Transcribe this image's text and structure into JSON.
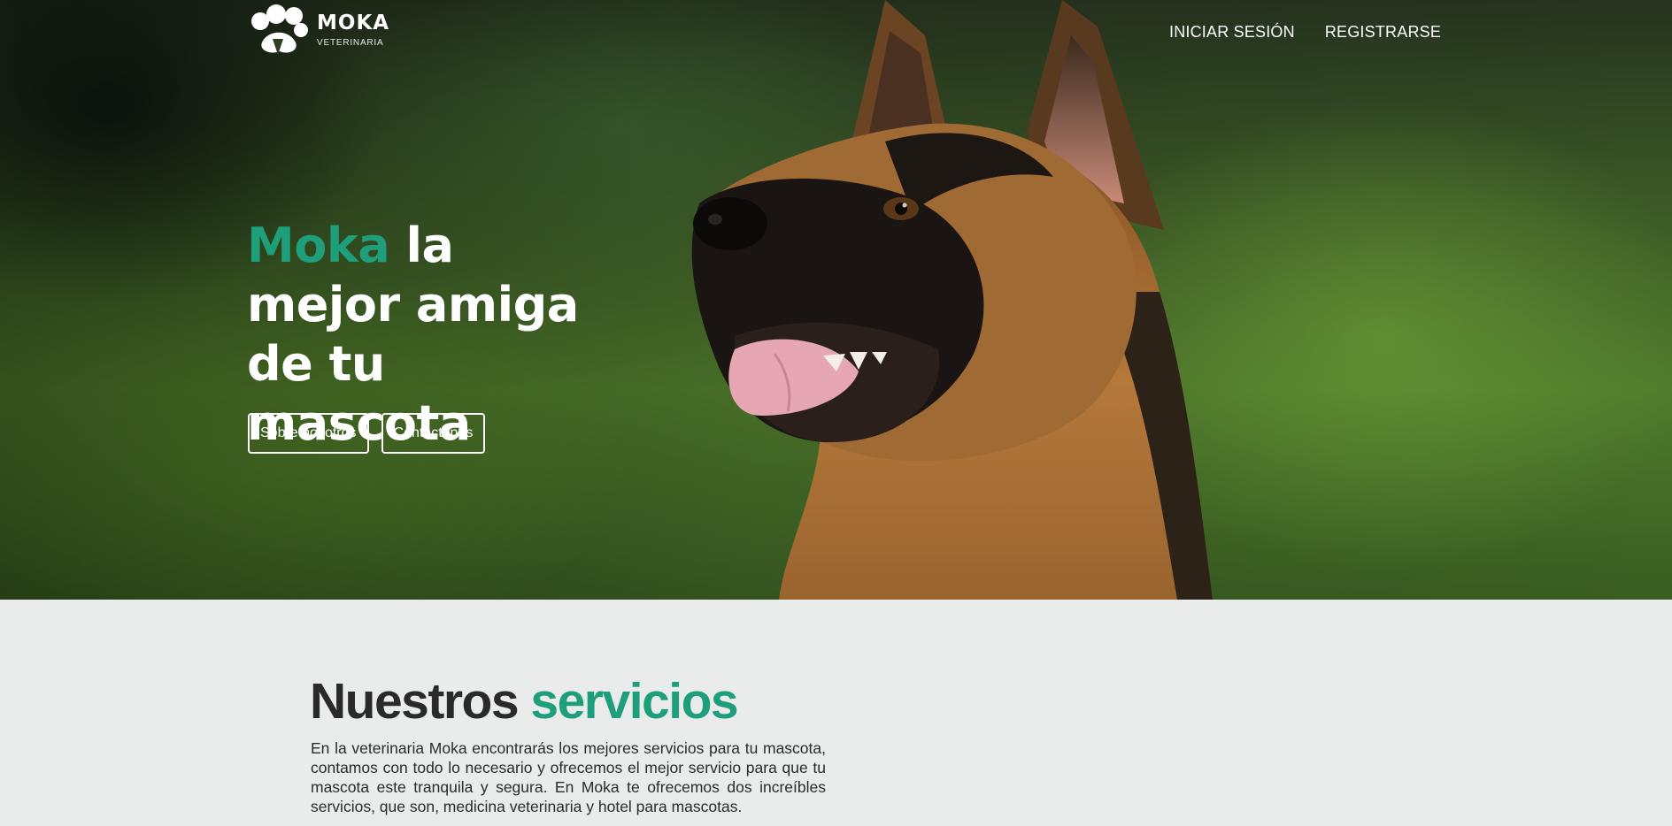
{
  "brand": {
    "name": "MOKA",
    "subtitle": "VETERINARIA"
  },
  "nav": {
    "login": "INICIAR SESIÓN",
    "register": "REGISTRARSE"
  },
  "hero": {
    "headline_brand": "Moka",
    "headline_rest": " la mejor amiga de tu mascota",
    "buttons": {
      "about": "Sobre nosotros",
      "contact": "Contáctenos"
    }
  },
  "services": {
    "title_plain": "Nuestros ",
    "title_accent": "servicios",
    "description": "En la veterinaria Moka encontrarás los mejores servicios para tu mascota, contamos con todo lo necesario y ofrecemos el mejor servicio para que tu mascota este tranquila y segura. En Moka te ofrecemos dos increíbles servicios, que son, medicina veterinaria y hotel para mascotas."
  },
  "colors": {
    "accent": "#1f9e7c",
    "section_bg": "#e9eceb",
    "text_dark": "#2a2a2a"
  },
  "icons": {
    "logo": "paw-dog-logo-icon"
  }
}
